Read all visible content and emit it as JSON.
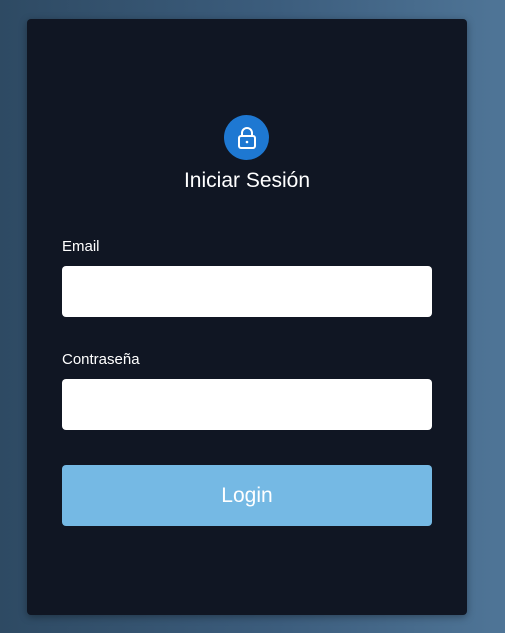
{
  "login": {
    "title": "Iniciar Sesión",
    "icon": "lock-icon",
    "email_label": "Email",
    "email_value": "",
    "password_label": "Contraseña",
    "password_value": "",
    "submit_label": "Login"
  },
  "colors": {
    "card_background": "#101623",
    "icon_badge": "#1e78d2",
    "button": "#75b9e4",
    "input_background": "#ffffff"
  }
}
